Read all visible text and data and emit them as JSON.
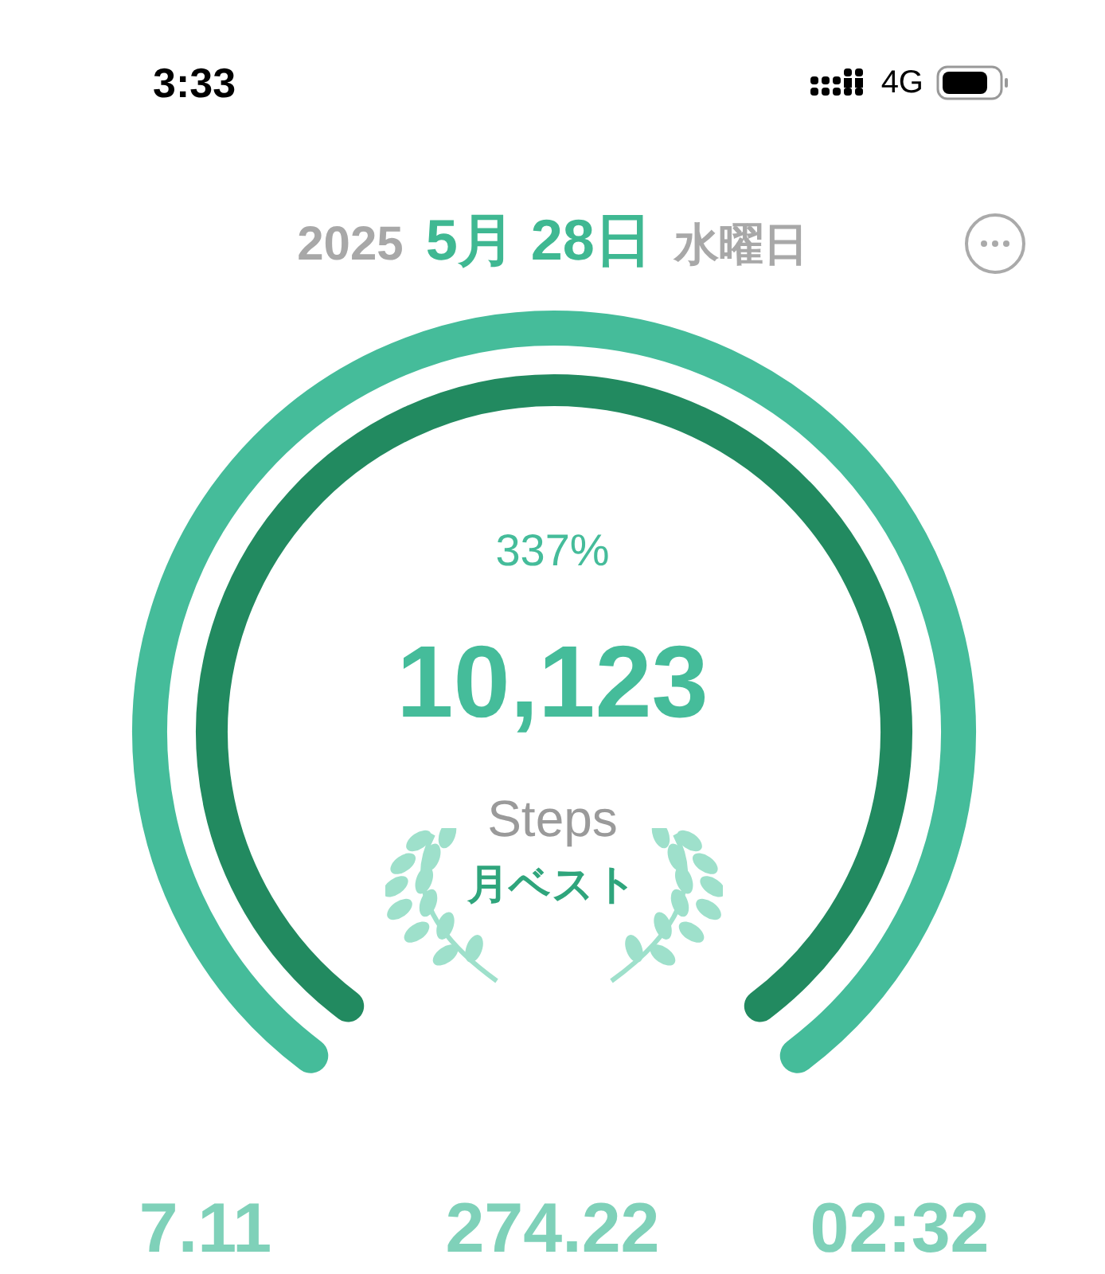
{
  "status_bar": {
    "time": "3:33",
    "network": "4G"
  },
  "header": {
    "year": "2025",
    "date": "5月 28日",
    "weekday": "水曜日"
  },
  "gauge": {
    "percent": "337%",
    "steps": "10,123",
    "unit": "Steps",
    "badge": "月ベスト"
  },
  "stats": [
    {
      "value": "7.11"
    },
    {
      "value": "274.22"
    },
    {
      "value": "02:32"
    }
  ]
}
